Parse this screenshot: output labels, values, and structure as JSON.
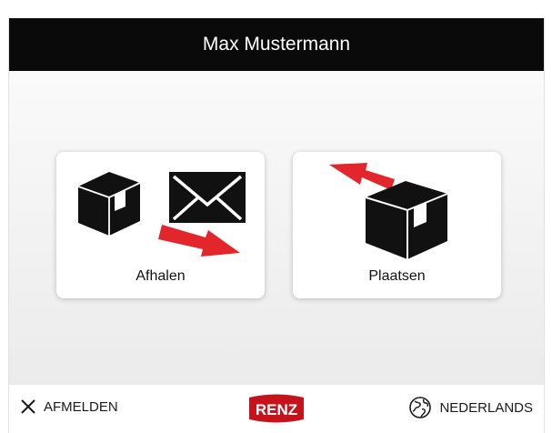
{
  "header": {
    "user_name": "Max Mustermann"
  },
  "tiles": [
    {
      "id": "pickup",
      "label": "Afhalen",
      "icons": [
        "package-icon",
        "envelope-icon",
        "arrow-out-icon"
      ]
    },
    {
      "id": "deposit",
      "label": "Plaatsen",
      "icons": [
        "package-icon",
        "arrow-in-icon"
      ]
    }
  ],
  "footer": {
    "logout_label": "AFMELDEN",
    "logout_icon": "close-icon",
    "logo_text": "RENZ",
    "language_label": "NEDERLANDS",
    "language_icon": "globe-icon"
  },
  "colors": {
    "header_bg": "#0a0a0a",
    "accent_red": "#e2262c",
    "logo_red": "#c5131b"
  }
}
